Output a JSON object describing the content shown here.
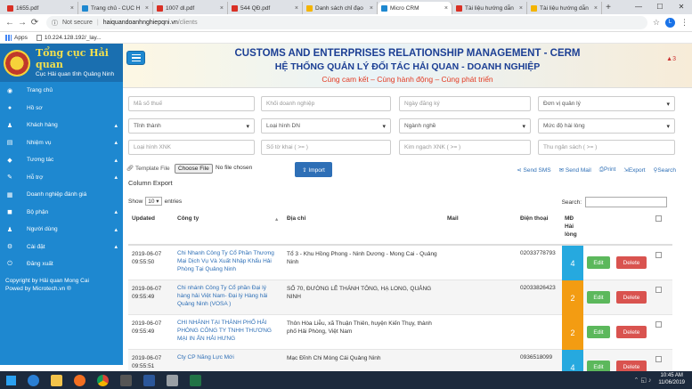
{
  "browser": {
    "tabs": [
      {
        "label": "1655.pdf",
        "color": "#d93025"
      },
      {
        "label": "Trang chủ - CỤC H",
        "color": "#1e88d0"
      },
      {
        "label": "1007 dl.pdf",
        "color": "#d93025"
      },
      {
        "label": "544 QĐ.pdf",
        "color": "#d93025"
      },
      {
        "label": "Danh sách chỉ đạo",
        "color": "#f4b400"
      },
      {
        "label": "Micro CRM",
        "color": "#1e88d0",
        "active": true
      },
      {
        "label": "Tài liệu hướng dẫn",
        "color": "#d93025"
      },
      {
        "label": "Tài liệu hướng dẫn",
        "color": "#f4b400"
      }
    ],
    "security": "Not secure",
    "url_host": "haiquandoanhnghiepqni.vn",
    "url_path": "/clients",
    "bookmarks": {
      "apps": "Apps",
      "link": "10.224.128.192/_lay..."
    },
    "avatar_letter": "L"
  },
  "sidebar": {
    "logo_title": "Tổng cục Hải quan",
    "logo_subtitle": "Cục Hải quan tỉnh Quảng Ninh",
    "items": [
      {
        "label": "Trang chủ",
        "icon": "dashboard-icon",
        "glyph": "◉",
        "chev": ""
      },
      {
        "label": "Hồ sơ",
        "icon": "user-icon",
        "glyph": "●",
        "chev": ""
      },
      {
        "label": "Khách hàng",
        "icon": "users-icon",
        "glyph": "♟",
        "chev": "▴"
      },
      {
        "label": "Nhiệm vụ",
        "icon": "tasks-icon",
        "glyph": "▤",
        "chev": "▴"
      },
      {
        "label": "Tương tác",
        "icon": "interaction-icon",
        "glyph": "◆",
        "chev": "▴"
      },
      {
        "label": "Hỗ trợ",
        "icon": "support-icon",
        "glyph": "✎",
        "chev": "▴"
      },
      {
        "label": "Doanh nghiệp đánh giá",
        "icon": "rating-icon",
        "glyph": "▦",
        "chev": ""
      },
      {
        "label": "Bộ phận",
        "icon": "department-icon",
        "glyph": "◼",
        "chev": "▴"
      },
      {
        "label": "Người dùng",
        "icon": "user-group-icon",
        "glyph": "♟",
        "chev": "▴"
      },
      {
        "label": "Cài đặt",
        "icon": "settings-icon",
        "glyph": "⚙",
        "chev": "▴"
      },
      {
        "label": "Đăng xuất",
        "icon": "logout-icon",
        "glyph": "⏻",
        "chev": ""
      }
    ],
    "copyright_1": "Copyright by Hải quan Mong Cai",
    "copyright_2": "Powed by Microtech.vn ®"
  },
  "header": {
    "title_en": "CUSTOMS AND ENTERPRISES RELATIONSHIP MANAGEMENT - CERM",
    "title_vi": "HỆ THỐNG QUẢN LÝ ĐỐI TÁC HẢI QUAN - DOANH NGHIỆP",
    "slogan": "Cùng cam kết – Cùng hành động – Cùng phát triển",
    "notif": "▲3"
  },
  "filters": {
    "mst": "Mã số thuế",
    "khoi": "Khối doanh nghiệp",
    "ngay": "Ngày đăng ký",
    "donvi": "Đơn vị quản lý",
    "tinh": "Tỉnh thành",
    "loaihinh": "Loại hình DN",
    "nganh": "Ngành nghề",
    "muc": "Mức độ hài lòng",
    "xnk": "Loại hình XNK",
    "sotokhai": "Số tờ khai ( >= )",
    "kimngach": "Kim ngạch XNK ( >= )",
    "thungan": "Thu ngân sách ( >= )"
  },
  "toolbar": {
    "template": "Template File",
    "choose": "Choose File",
    "nofile": "No file chosen",
    "import": "⇪ Import",
    "sms": "Send SMS",
    "mail": "Send Mail",
    "print": "Print",
    "export": "Export",
    "search": "Search",
    "column_export": "Column Export"
  },
  "table": {
    "show": "Show",
    "entries_value": "10 ▾",
    "entries": "entries",
    "search_label": "Search:",
    "headers": {
      "updated": "Updated",
      "company": "Công ty",
      "address": "Địa chỉ",
      "mail": "Mail",
      "phone": "Điện thoại",
      "md": "MĐ Hài lòng"
    },
    "edit_label": "Edit",
    "delete_label": "Delete",
    "rows": [
      {
        "date": "2019-06-07",
        "time": "09:55:50",
        "company": "Chi Nhanh Công Ty Cổ Phần Thương Mại Dịch Vụ Và Xuất Nhập Khẩu Hải Phòng Tại Quảng Ninh",
        "address": "Tổ 3 - Khu Hồng Phong - Ninh Dương - Mong Cai - Quảng Ninh",
        "phone": "02033778793",
        "md": "4",
        "md_color": "#26a9df"
      },
      {
        "date": "2019-06-07",
        "time": "09:55:49",
        "company": "Chi nhánh Công Ty Cổ phần Đại lý hàng hải Việt Nam- Đại lý Hàng hải Quảng Ninh (VOSA )",
        "address": "SỐ 70, ĐƯỜNG LÊ THÁNH TÔNG, HẠ LONG, QUẢNG NINH",
        "phone": "02033826423",
        "md": "2",
        "md_color": "#f39c12"
      },
      {
        "date": "2019-06-07",
        "time": "09:55:49",
        "company": "CHI NHÁNH TẠI THÀNH PHỐ HẢI PHÒNG CÔNG TY TNHH THƯƠNG MẠI IN ẤN HẢI HƯNG",
        "address": "Thôn Hòa Liễu, xã Thuận Thiên, huyện Kiến Thụy, thành phố Hải Phòng, Việt Nam",
        "phone": "",
        "md": "2",
        "md_color": "#f39c12"
      },
      {
        "date": "2019-06-07",
        "time": "09:55:51",
        "company": "Cty CP Năng Lực Mới",
        "address": "Mạc Đĩnh Chi Móng Cái Quảng Ninh",
        "phone": "0936518099",
        "md": "4",
        "md_color": "#26a9df"
      }
    ]
  },
  "taskbar": {
    "time": "10:45 AM",
    "date": "11/06/2019"
  }
}
